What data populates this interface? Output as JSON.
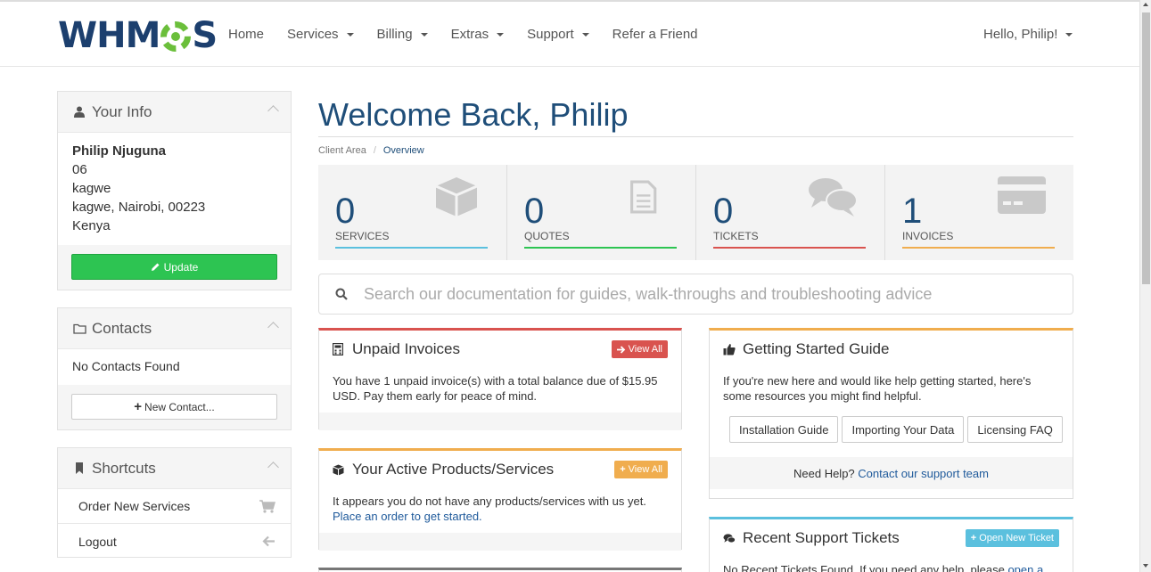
{
  "brand": {
    "logo_text_left": "WHM",
    "logo_text_right": "S"
  },
  "nav": {
    "items": [
      {
        "label": "Home",
        "dropdown": false
      },
      {
        "label": "Services",
        "dropdown": true
      },
      {
        "label": "Billing",
        "dropdown": true
      },
      {
        "label": "Extras",
        "dropdown": true
      },
      {
        "label": "Support",
        "dropdown": true
      },
      {
        "label": "Refer a Friend",
        "dropdown": false
      }
    ],
    "user": "Hello, Philip!"
  },
  "sidebar": {
    "info": {
      "title": "Your Info",
      "name": "Philip Njuguna",
      "lines": [
        "06",
        "kagwe",
        "kagwe, Nairobi, 00223",
        "Kenya"
      ],
      "update_label": "Update"
    },
    "contacts": {
      "title": "Contacts",
      "empty": "No Contacts Found",
      "new_label": "New Contact..."
    },
    "shortcuts": {
      "title": "Shortcuts",
      "items": [
        {
          "label": "Order New Services",
          "icon": "cart-icon"
        },
        {
          "label": "Logout",
          "icon": "arrow-left-icon"
        }
      ]
    }
  },
  "main": {
    "welcome": "Welcome Back, Philip",
    "breadcrumb": {
      "root": "Client Area",
      "current": "Overview",
      "separator": "/"
    },
    "stats": [
      {
        "value": "0",
        "label": "SERVICES",
        "color": "#5bc0de",
        "icon": "cube-icon"
      },
      {
        "value": "0",
        "label": "QUOTES",
        "color": "#2dc452",
        "icon": "file-icon"
      },
      {
        "value": "0",
        "label": "TICKETS",
        "color": "#d9534f",
        "icon": "comments-icon"
      },
      {
        "value": "1",
        "label": "INVOICES",
        "color": "#f0ad4e",
        "icon": "credit-card-icon"
      }
    ],
    "search_placeholder": "Search our documentation for guides, walk-throughs and troubleshooting advice",
    "unpaid": {
      "title": "Unpaid Invoices",
      "button": "View All",
      "text": "You have 1 unpaid invoice(s) with a total balance due of $15.95 USD. Pay them early for peace of mind.",
      "color": "#d9534f"
    },
    "products": {
      "title": "Your Active Products/Services",
      "button": "View All",
      "text": "It appears you do not have any products/services with us yet.",
      "link": "Place an order to get started.",
      "color": "#f0ad4e"
    },
    "guide": {
      "title": "Getting Started Guide",
      "text": "If you're new here and would like help getting started, here's some resources you might find helpful.",
      "buttons": [
        "Installation Guide",
        "Importing Your Data",
        "Licensing FAQ"
      ],
      "need_help": "Need Help?",
      "contact_link": "Contact our support team",
      "color": "#f0ad4e"
    },
    "tickets": {
      "title": "Recent Support Tickets",
      "button": "Open New Ticket",
      "text": "No Recent Tickets Found. If you need any help, please",
      "link": "open a",
      "color": "#5bc0de"
    }
  }
}
